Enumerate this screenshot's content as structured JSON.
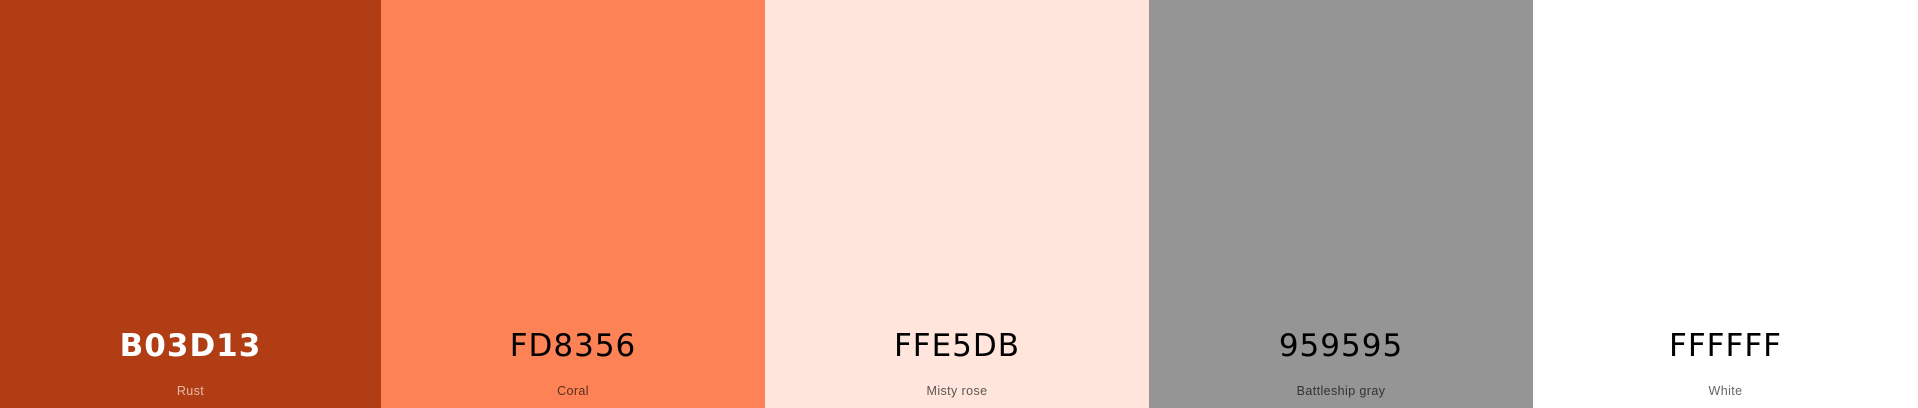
{
  "swatches": [
    {
      "hex": "B03D13",
      "name": "Rust",
      "color": "#B03D13",
      "text_color": "#FFFFFF",
      "name_color": "#E8B9A6",
      "hex_weight": "700"
    },
    {
      "hex": "FD8356",
      "name": "Coral",
      "color": "#FD8356",
      "text_color": "#000000",
      "name_color": "#5A2E1E",
      "hex_weight": "500"
    },
    {
      "hex": "FFE5DB",
      "name": "Misty rose",
      "color": "#FFE5DB",
      "text_color": "#000000",
      "name_color": "#5E5552",
      "hex_weight": "500"
    },
    {
      "hex": "959595",
      "name": "Battleship gray",
      "color": "#959595",
      "text_color": "#000000",
      "name_color": "#333333",
      "hex_weight": "500"
    },
    {
      "hex": "FFFFFF",
      "name": "White",
      "color": "#FFFFFF",
      "text_color": "#000000",
      "name_color": "#666666",
      "hex_weight": "500"
    }
  ]
}
